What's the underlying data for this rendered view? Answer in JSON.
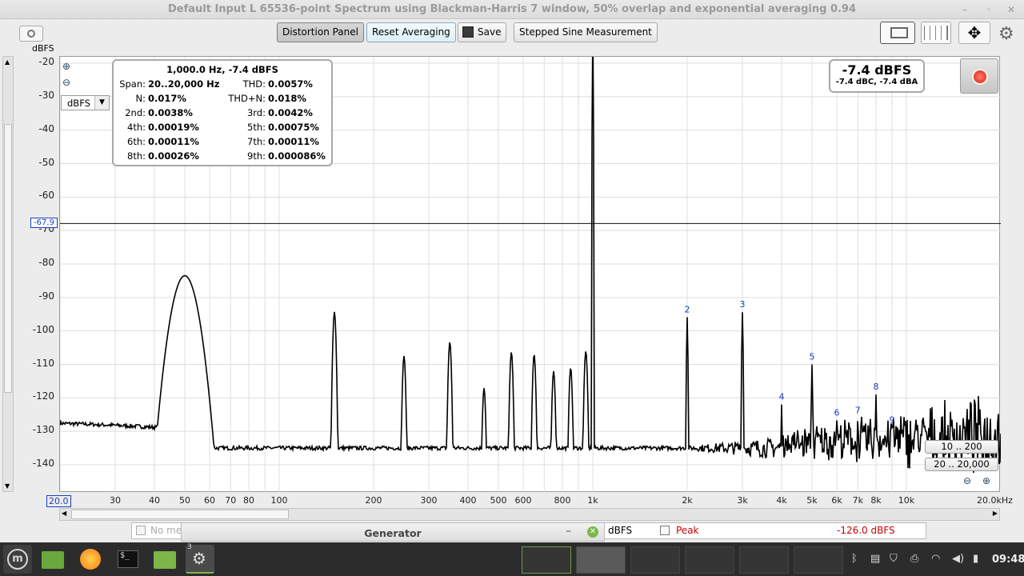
{
  "window": {
    "title": "Default Input L 65536-point Spectrum using Blackman-Harris 7 window, 50% overlap and exponential averaging 0.94",
    "minimize": "–",
    "maximize": "◦",
    "close": "✕"
  },
  "toolbar": {
    "distortion_panel": "Distortion Panel",
    "reset_averaging": "Reset Averaging",
    "save": "Save",
    "stepped_sine": "Stepped Sine Measurement"
  },
  "plot": {
    "y_unit": "dBFS",
    "y_unit_select": "dBFS",
    "cursor_level": "-67.9",
    "y_ticks": [
      "-20",
      "-30",
      "-40",
      "-50",
      "-60",
      "-70",
      "-80",
      "-90",
      "-100",
      "-110",
      "-120",
      "-130",
      "-140"
    ],
    "x_ticks": [
      "20.0",
      "30",
      "40",
      "50",
      "60",
      "70",
      "80",
      "100",
      "200",
      "300",
      "400",
      "500",
      "600",
      "800",
      "1k",
      "2k",
      "3k",
      "4k",
      "5k",
      "6k",
      "7k",
      "8k",
      "10k",
      "20.0kHz"
    ],
    "harmonic_labels": [
      "2",
      "3",
      "4",
      "5",
      "6",
      "7",
      "8",
      "9"
    ]
  },
  "distortion": {
    "header": "1,000.0 Hz, -7.4 dBFS",
    "rows": [
      {
        "l1": "Span:",
        "v1": "20..20,000 Hz",
        "l2": "THD:",
        "v2": "0.0057%"
      },
      {
        "l1": "N:",
        "v1": "0.017%",
        "l2": "THD+N:",
        "v2": "0.018%"
      },
      {
        "l1": "2nd:",
        "v1": "0.0038%",
        "l2": "3rd:",
        "v2": "0.0042%"
      },
      {
        "l1": "4th:",
        "v1": "0.00019%",
        "l2": "5th:",
        "v2": "0.00075%"
      },
      {
        "l1": "6th:",
        "v1": "0.00011%",
        "l2": "7th:",
        "v2": "0.00011%"
      },
      {
        "l1": "8th:",
        "v1": "0.00026%",
        "l2": "9th:",
        "v2": "0.000086%"
      }
    ]
  },
  "level": {
    "main": "-7.4 dBFS",
    "sub": "-7.4 dBC, -7.4 dBA"
  },
  "ranges": {
    "y_range": "10 .. 200",
    "x_range": "20 .. 20,000"
  },
  "bottom": {
    "no_measurement": "No me",
    "generator_title": "Generator",
    "gen_min": "–",
    "left_unit": "dBFS",
    "peak_label": "Peak",
    "peak_value": "-126.0 dBFS"
  },
  "taskbar": {
    "badge": "3",
    "clock": "09:48"
  },
  "chart_data": {
    "type": "line",
    "xscale": "log",
    "xlim": [
      20,
      20000
    ],
    "ylim": [
      -148,
      -18
    ],
    "ylabel": "dBFS",
    "grid": true,
    "fundamental": {
      "freq": 1000,
      "level": -7.4
    },
    "harmonics": [
      {
        "n": 2,
        "freq": 2000,
        "level": -95.9
      },
      {
        "n": 3,
        "freq": 3000,
        "level": -94.4
      },
      {
        "n": 4,
        "freq": 4000,
        "level": -122.0
      },
      {
        "n": 5,
        "freq": 5000,
        "level": -110.0
      },
      {
        "n": 6,
        "freq": 6000,
        "level": -126.7
      },
      {
        "n": 7,
        "freq": 7000,
        "level": -126.0
      },
      {
        "n": 8,
        "freq": 8000,
        "level": -119.0
      },
      {
        "n": 9,
        "freq": 9000,
        "level": -128.9
      }
    ],
    "spurs": [
      {
        "freq": 50,
        "level": -83.5
      },
      {
        "freq": 150,
        "level": -94.3
      },
      {
        "freq": 250,
        "level": -107.5
      },
      {
        "freq": 350,
        "level": -103.3
      },
      {
        "freq": 450,
        "level": -117.1
      },
      {
        "freq": 550,
        "level": -106.3
      },
      {
        "freq": 650,
        "level": -107.0
      },
      {
        "freq": 750,
        "level": -112.0
      },
      {
        "freq": 850,
        "level": -111.0
      },
      {
        "freq": 950,
        "level": -106.0
      }
    ],
    "noise_floor": -135
  }
}
